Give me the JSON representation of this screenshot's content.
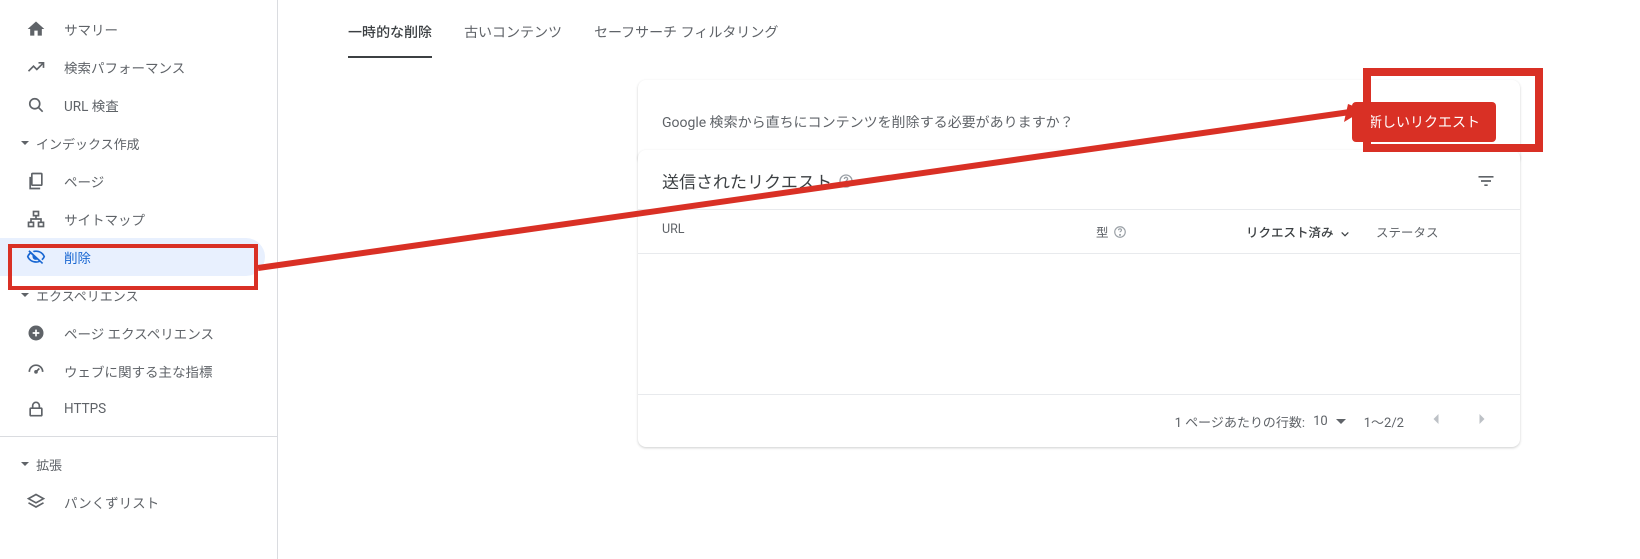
{
  "sidebar": {
    "items": [
      {
        "label": "サマリー",
        "icon": "home"
      },
      {
        "label": "検索パフォーマンス",
        "icon": "trend"
      },
      {
        "label": "URL 検査",
        "icon": "search"
      }
    ],
    "section_indexing": {
      "label": "インデックス作成"
    },
    "indexing_items": [
      {
        "label": "ページ",
        "icon": "pages"
      },
      {
        "label": "サイトマップ",
        "icon": "sitemap"
      },
      {
        "label": "削除",
        "icon": "eye-off"
      }
    ],
    "section_experience": {
      "label": "エクスペリエンス"
    },
    "experience_items": [
      {
        "label": "ページ エクスペリエンス",
        "icon": "circle-plus"
      },
      {
        "label": "ウェブに関する主な指標",
        "icon": "speed"
      },
      {
        "label": "HTTPS",
        "icon": "lock"
      }
    ],
    "section_enhance": {
      "label": "拡張"
    },
    "enhance_items": [
      {
        "label": "パンくずリスト",
        "icon": "layers"
      }
    ]
  },
  "tabs": [
    {
      "label": "一時的な削除"
    },
    {
      "label": "古いコンテンツ"
    },
    {
      "label": "セーフサーチ フィルタリング"
    }
  ],
  "cta_card": {
    "text": "Google 検索から直ちにコンテンツを削除する必要がありますか？",
    "button": "新しいリクエスト"
  },
  "requests_card": {
    "title": "送信されたリクエスト",
    "columns": {
      "url": "URL",
      "type": "型",
      "requested": "リクエスト済み",
      "status": "ステータス"
    },
    "footer": {
      "rows_label": "1 ページあたりの行数:",
      "rows_value": "10",
      "range": "1～2/2"
    }
  },
  "annotation_color": "#d93025"
}
